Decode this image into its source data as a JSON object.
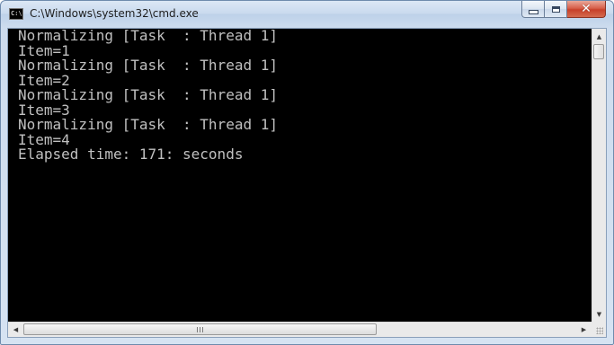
{
  "window": {
    "title": "C:\\Windows\\system32\\cmd.exe",
    "icon_label": "C:\\",
    "icon": "cmd-icon"
  },
  "caption_buttons": {
    "minimize_icon": "minimize-icon",
    "maximize_icon": "maximize-icon",
    "close_icon": "close-icon",
    "close_glyph": "✕"
  },
  "console": {
    "text_color": "#c0c0c0",
    "background": "#000000",
    "lines": [
      "Normalizing [Task  : Thread 1]",
      "Item=1",
      "Normalizing [Task  : Thread 1]",
      "Item=2",
      "Normalizing [Task  : Thread 1]",
      "Item=3",
      "Normalizing [Task  : Thread 1]",
      "Item=4",
      "Elapsed time: 171: seconds"
    ]
  },
  "scrollbars": {
    "up_arrow": "▲",
    "down_arrow": "▼",
    "left_arrow": "◀",
    "right_arrow": "▶"
  }
}
